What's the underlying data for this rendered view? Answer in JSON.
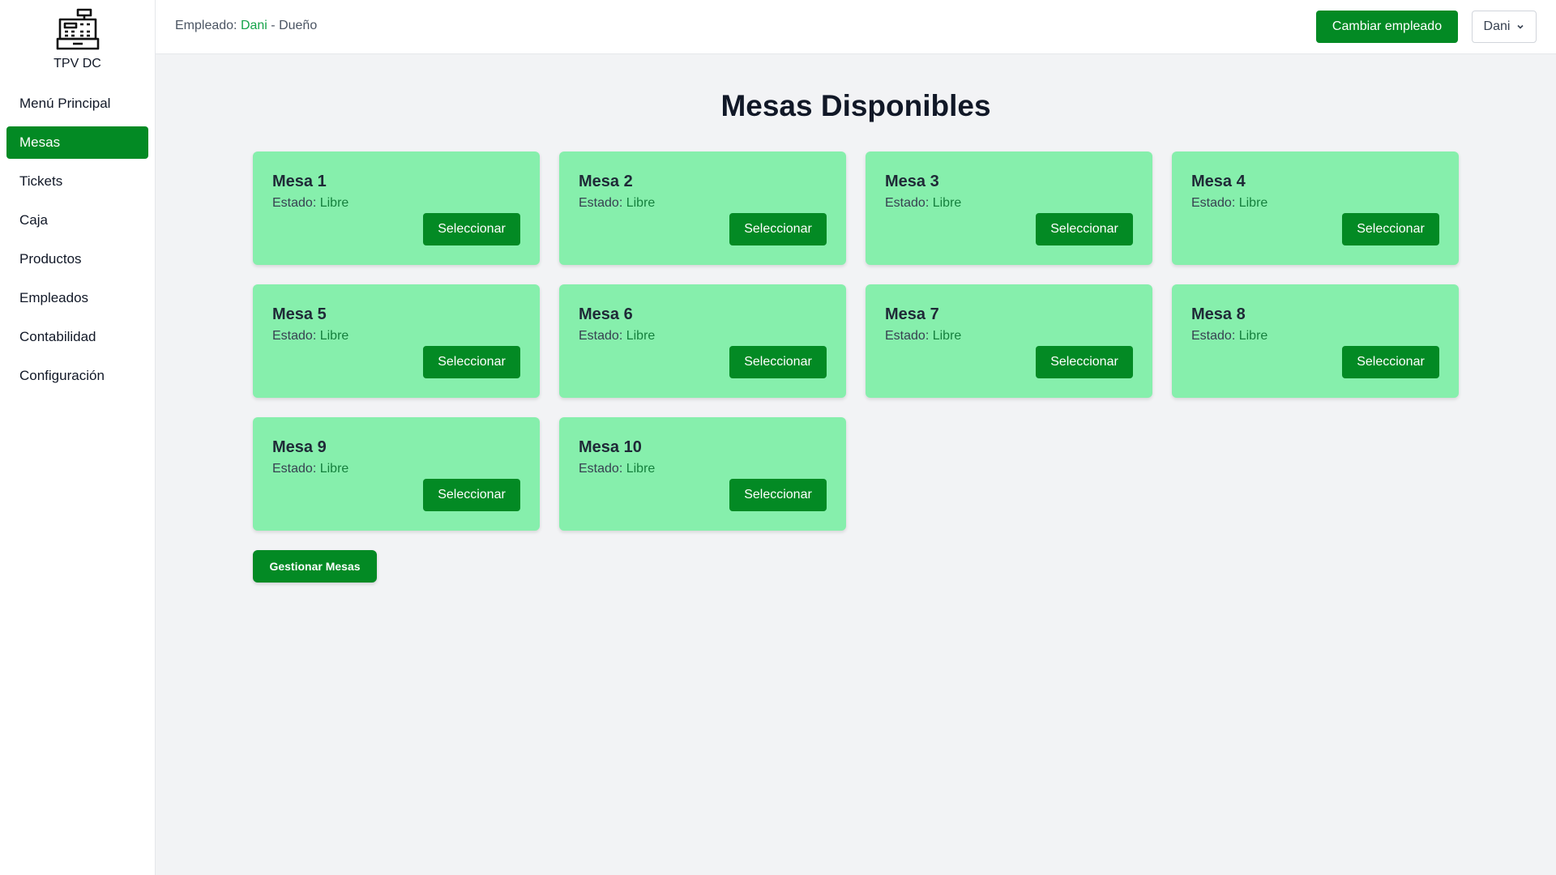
{
  "app": {
    "name": "TPV DC",
    "logo_icon": "cash-register-icon"
  },
  "colors": {
    "primary": "#038a24",
    "card_background": "#86efac",
    "status_free": "#15803d",
    "employee_name": "#16a34a",
    "page_background": "#f2f3f5"
  },
  "sidebar": {
    "items": [
      {
        "label": "Menú Principal",
        "active": false
      },
      {
        "label": "Mesas",
        "active": true
      },
      {
        "label": "Tickets",
        "active": false
      },
      {
        "label": "Caja",
        "active": false
      },
      {
        "label": "Productos",
        "active": false
      },
      {
        "label": "Empleados",
        "active": false
      },
      {
        "label": "Contabilidad",
        "active": false
      },
      {
        "label": "Configuración",
        "active": false
      }
    ]
  },
  "header": {
    "employee_label": "Empleado:",
    "employee_name": "Dani",
    "separator": " - ",
    "employee_role": "Dueño",
    "change_button": "Cambiar empleado",
    "user_menu": "Dani",
    "user_menu_icon": "chevron-down-icon"
  },
  "main": {
    "title": "Mesas Disponibles",
    "status_label": "Estado:",
    "select_label": "Seleccionar",
    "tables": [
      {
        "name": "Mesa 1",
        "status": "Libre"
      },
      {
        "name": "Mesa 2",
        "status": "Libre"
      },
      {
        "name": "Mesa 3",
        "status": "Libre"
      },
      {
        "name": "Mesa 4",
        "status": "Libre"
      },
      {
        "name": "Mesa 5",
        "status": "Libre"
      },
      {
        "name": "Mesa 6",
        "status": "Libre"
      },
      {
        "name": "Mesa 7",
        "status": "Libre"
      },
      {
        "name": "Mesa 8",
        "status": "Libre"
      },
      {
        "name": "Mesa 9",
        "status": "Libre"
      },
      {
        "name": "Mesa 10",
        "status": "Libre"
      }
    ],
    "manage_button": "Gestionar Mesas"
  }
}
